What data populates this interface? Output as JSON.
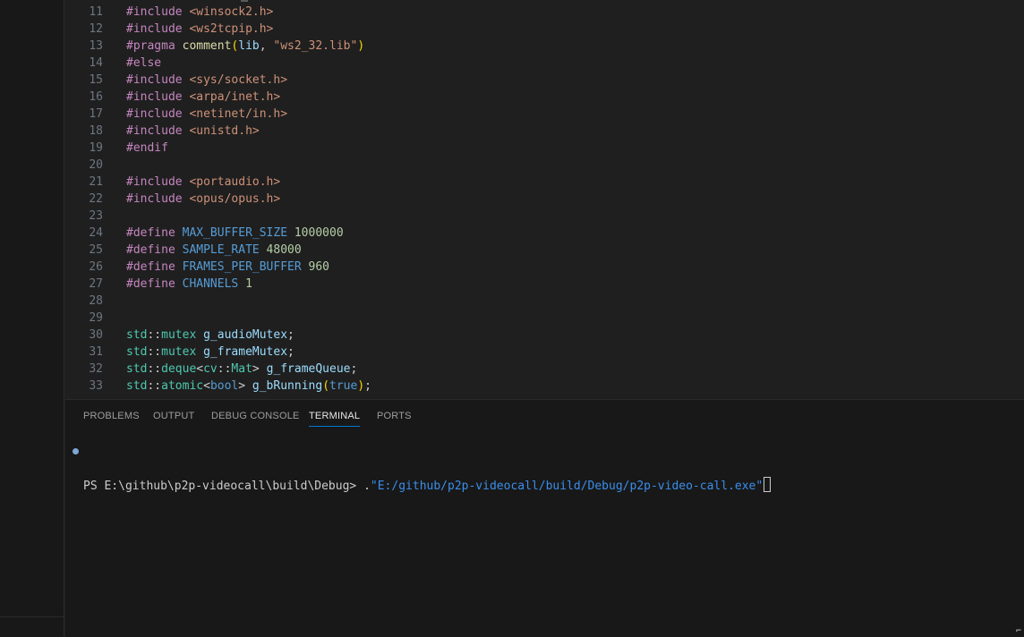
{
  "editor": {
    "lines": [
      {
        "num": "11",
        "tokens": [
          [
            "k",
            "#include"
          ],
          [
            "p",
            " "
          ],
          [
            "s",
            "<winsock2.h>"
          ]
        ]
      },
      {
        "num": "12",
        "tokens": [
          [
            "k",
            "#include"
          ],
          [
            "p",
            " "
          ],
          [
            "s",
            "<ws2tcpip.h>"
          ]
        ]
      },
      {
        "num": "13",
        "tokens": [
          [
            "k",
            "#pragma"
          ],
          [
            "p",
            " "
          ],
          [
            "f",
            "comment"
          ],
          [
            "br1",
            "("
          ],
          [
            "v",
            "lib"
          ],
          [
            "p",
            ", "
          ],
          [
            "s",
            "\"ws2_32.lib\""
          ],
          [
            "br1",
            ")"
          ]
        ]
      },
      {
        "num": "14",
        "tokens": [
          [
            "k",
            "#else"
          ]
        ]
      },
      {
        "num": "15",
        "tokens": [
          [
            "k",
            "#include"
          ],
          [
            "p",
            " "
          ],
          [
            "s",
            "<sys/socket.h>"
          ]
        ]
      },
      {
        "num": "16",
        "tokens": [
          [
            "k",
            "#include"
          ],
          [
            "p",
            " "
          ],
          [
            "s",
            "<arpa/inet.h>"
          ]
        ]
      },
      {
        "num": "17",
        "tokens": [
          [
            "k",
            "#include"
          ],
          [
            "p",
            " "
          ],
          [
            "s",
            "<netinet/in.h>"
          ]
        ]
      },
      {
        "num": "18",
        "tokens": [
          [
            "k",
            "#include"
          ],
          [
            "p",
            " "
          ],
          [
            "s",
            "<unistd.h>"
          ]
        ]
      },
      {
        "num": "19",
        "tokens": [
          [
            "k",
            "#endif"
          ]
        ]
      },
      {
        "num": "20",
        "tokens": []
      },
      {
        "num": "21",
        "tokens": [
          [
            "k",
            "#include"
          ],
          [
            "p",
            " "
          ],
          [
            "s",
            "<portaudio.h>"
          ]
        ]
      },
      {
        "num": "22",
        "tokens": [
          [
            "k",
            "#include"
          ],
          [
            "p",
            " "
          ],
          [
            "s",
            "<opus/opus.h>"
          ]
        ]
      },
      {
        "num": "23",
        "tokens": []
      },
      {
        "num": "24",
        "tokens": [
          [
            "k",
            "#define"
          ],
          [
            "p",
            " "
          ],
          [
            "b",
            "MAX_BUFFER_SIZE"
          ],
          [
            "p",
            " "
          ],
          [
            "n",
            "1000000"
          ]
        ]
      },
      {
        "num": "25",
        "tokens": [
          [
            "k",
            "#define"
          ],
          [
            "p",
            " "
          ],
          [
            "b",
            "SAMPLE_RATE"
          ],
          [
            "p",
            " "
          ],
          [
            "n",
            "48000"
          ]
        ]
      },
      {
        "num": "26",
        "tokens": [
          [
            "k",
            "#define"
          ],
          [
            "p",
            " "
          ],
          [
            "b",
            "FRAMES_PER_BUFFER"
          ],
          [
            "p",
            " "
          ],
          [
            "n",
            "960"
          ]
        ]
      },
      {
        "num": "27",
        "tokens": [
          [
            "k",
            "#define"
          ],
          [
            "p",
            " "
          ],
          [
            "b",
            "CHANNELS"
          ],
          [
            "p",
            " "
          ],
          [
            "n",
            "1"
          ]
        ]
      },
      {
        "num": "28",
        "tokens": []
      },
      {
        "num": "29",
        "tokens": []
      },
      {
        "num": "30",
        "tokens": [
          [
            "t",
            "std"
          ],
          [
            "p",
            "::"
          ],
          [
            "t",
            "mutex"
          ],
          [
            "p",
            " "
          ],
          [
            "v",
            "g_audioMutex"
          ],
          [
            "p",
            ";"
          ]
        ]
      },
      {
        "num": "31",
        "tokens": [
          [
            "t",
            "std"
          ],
          [
            "p",
            "::"
          ],
          [
            "t",
            "mutex"
          ],
          [
            "p",
            " "
          ],
          [
            "v",
            "g_frameMutex"
          ],
          [
            "p",
            ";"
          ]
        ]
      },
      {
        "num": "32",
        "tokens": [
          [
            "t",
            "std"
          ],
          [
            "p",
            "::"
          ],
          [
            "t",
            "deque"
          ],
          [
            "p",
            "<"
          ],
          [
            "t",
            "cv"
          ],
          [
            "p",
            "::"
          ],
          [
            "t",
            "Mat"
          ],
          [
            "p",
            "> "
          ],
          [
            "v",
            "g_frameQueue"
          ],
          [
            "p",
            ";"
          ]
        ]
      },
      {
        "num": "33",
        "tokens": [
          [
            "t",
            "std"
          ],
          [
            "p",
            "::"
          ],
          [
            "t",
            "atomic"
          ],
          [
            "p",
            "<"
          ],
          [
            "b",
            "bool"
          ],
          [
            "p",
            "> "
          ],
          [
            "v",
            "g_bRunning"
          ],
          [
            "br1",
            "("
          ],
          [
            "b",
            "true"
          ],
          [
            "br1",
            ")"
          ],
          [
            "p",
            ";"
          ]
        ]
      }
    ]
  },
  "panel": {
    "tabs": [
      "PROBLEMS",
      "OUTPUT",
      "DEBUG CONSOLE",
      "TERMINAL",
      "PORTS"
    ],
    "active_tab": "TERMINAL",
    "terminal": {
      "prompt": "PS E:\\github\\p2p-videocall\\build\\Debug> ",
      "cmd_prefix": ".",
      "cmd": "\"E:/github/p2p-videocall/build/Debug/p2p-video-call.exe\""
    }
  },
  "colors": {
    "keyword": "#c586c0",
    "string": "#ce9178",
    "type": "#4ec9b0",
    "variable": "#9cdcfe",
    "number": "#b5cea8",
    "accent": "#0078d4"
  }
}
